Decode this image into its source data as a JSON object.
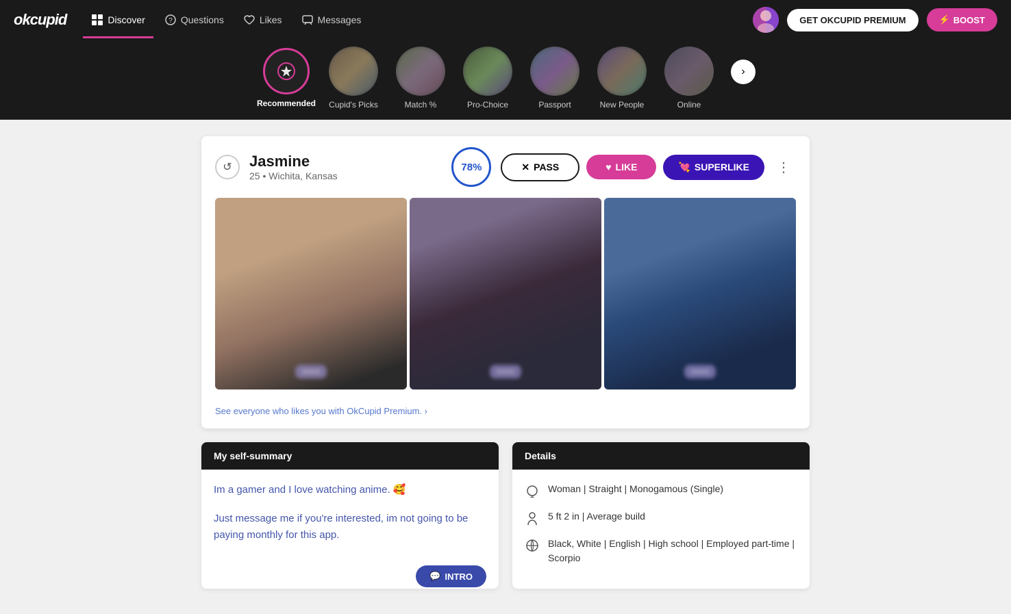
{
  "app": {
    "logo": "okcupid",
    "premium_btn": "GET OKCUPID PREMIUM",
    "boost_btn": "⚡ BOOST"
  },
  "nav": {
    "items": [
      {
        "label": "Discover",
        "icon": "grid",
        "active": true
      },
      {
        "label": "Questions",
        "icon": "question"
      },
      {
        "label": "Likes",
        "icon": "heart"
      },
      {
        "label": "Messages",
        "icon": "message"
      }
    ]
  },
  "discovery": {
    "categories": [
      {
        "label": "Recommended",
        "active": true,
        "icon": "sun"
      },
      {
        "label": "Cupid's Picks",
        "active": false
      },
      {
        "label": "Match %",
        "active": false
      },
      {
        "label": "Pro-Choice",
        "active": false
      },
      {
        "label": "Passport",
        "active": false
      },
      {
        "label": "New People",
        "active": false
      },
      {
        "label": "Online",
        "active": false
      }
    ],
    "next_btn": "›"
  },
  "profile": {
    "name": "Jasmine",
    "age": "25",
    "location": "Wichita, Kansas",
    "match_pct": "78%",
    "pass_btn": "PASS",
    "like_btn": "LIKE",
    "superlike_btn": "SUPERLIKE",
    "premium_link": "See everyone who likes you with OkCupid Premium. ›"
  },
  "self_summary": {
    "header": "My self-summary",
    "text1": "Im a gamer and I love watching anime. 🥰",
    "text2": "Just message me if you're interested, im not going to be paying monthly for this app.",
    "intro_btn": "INTRO"
  },
  "details": {
    "header": "Details",
    "rows": [
      {
        "icon": "♀",
        "text": "Woman | Straight | Monogamous (Single)"
      },
      {
        "icon": "↕",
        "text": "5 ft 2 in | Average build"
      },
      {
        "icon": "🌐",
        "text": "Black, White | English | High school | Employed part-time | Scorpio"
      }
    ]
  }
}
